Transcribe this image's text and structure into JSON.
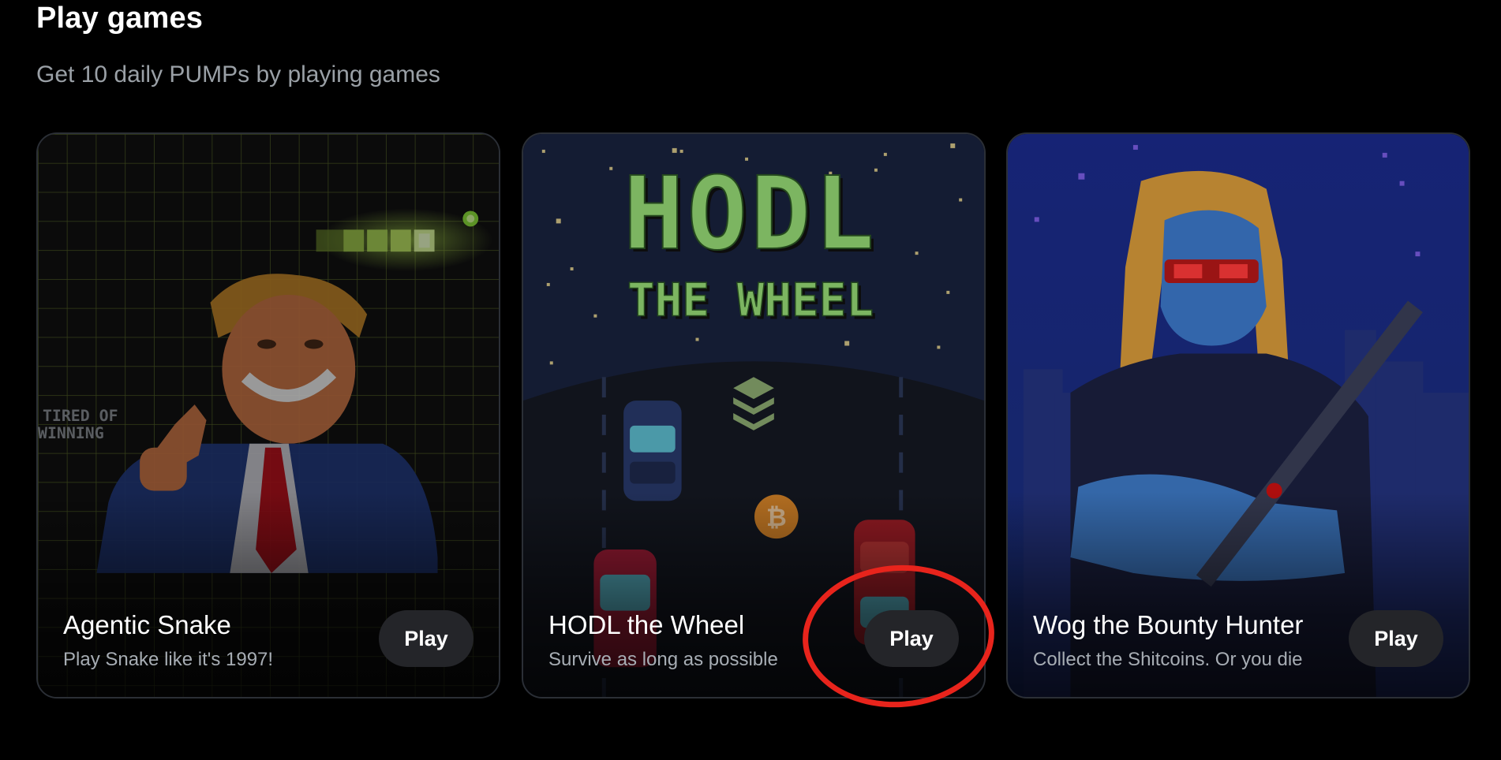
{
  "header": {
    "title": "Play games",
    "subtitle": "Get 10 daily PUMPs by playing games"
  },
  "cards": [
    {
      "title": "Agentic Snake",
      "description": "Play Snake like it's 1997!",
      "play_label": "Play",
      "art_text": "TIRED OF\nWINNING",
      "art_icon": "snake-game-art"
    },
    {
      "title": "HODL the Wheel",
      "description": "Survive as long as possible",
      "play_label": "Play",
      "art_text_line1": "HODL",
      "art_text_line2": "THE WHEEL",
      "art_icon": "racing-game-art"
    },
    {
      "title": "Wog the Bounty Hunter",
      "description": "Collect the Shitcoins. Or you die",
      "play_label": "Play",
      "art_icon": "bounty-hunter-art"
    }
  ],
  "colors": {
    "background": "#000000",
    "button": "#242529",
    "highlight": "#e8241c",
    "hodl_green": "#9be37a"
  }
}
